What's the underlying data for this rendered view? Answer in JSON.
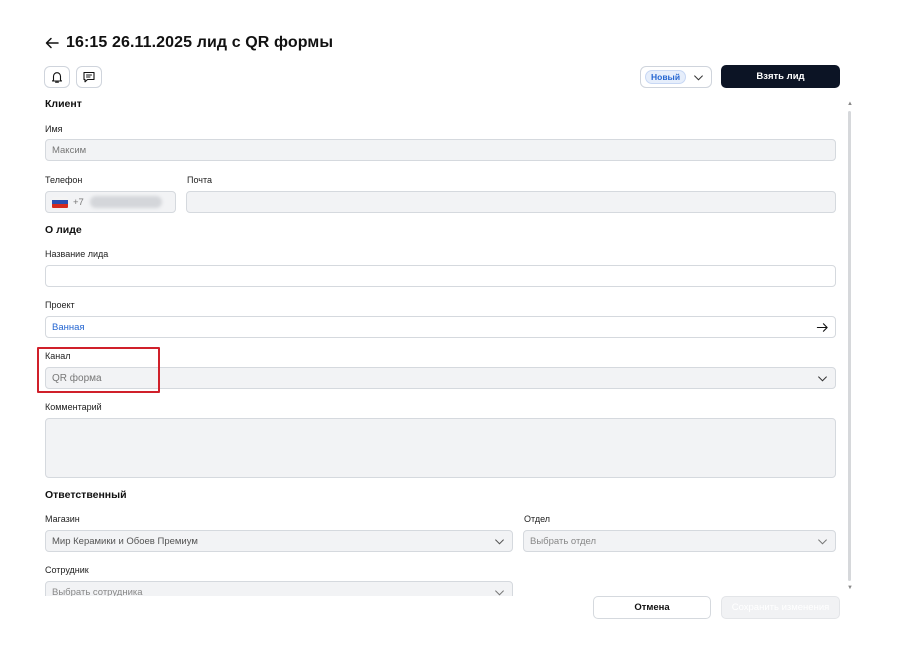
{
  "header": {
    "title": "16:15 26.11.2025 лид с QR формы",
    "status": "Новый",
    "take_lead_label": "Взять лид"
  },
  "toolbar": {
    "icons": [
      "bell-icon",
      "comment-icon"
    ]
  },
  "client": {
    "section_title": "Клиент",
    "name_label": "Имя",
    "name_value": "Максим",
    "phone_label": "Телефон",
    "phone_prefix": "+7",
    "email_label": "Почта",
    "email_value": ""
  },
  "lead": {
    "section_title": "О лиде",
    "lead_name_label": "Название лида",
    "lead_name_value": "",
    "project_label": "Проект",
    "project_value": "Ванная",
    "channel_label": "Канал",
    "channel_value": "QR форма",
    "comment_label": "Комментарий",
    "comment_value": ""
  },
  "responsible": {
    "section_title": "Ответственный",
    "store_label": "Магазин",
    "store_value": "Мир Керамики и Обоев Премиум",
    "department_label": "Отдел",
    "department_placeholder": "Выбрать отдел",
    "employee_label": "Сотрудник",
    "employee_placeholder": "Выбрать сотрудника"
  },
  "footer": {
    "cancel_label": "Отмена",
    "save_label": "Сохранить изменения"
  },
  "colors": {
    "primary": "#0c1425",
    "status_badge": "#2566d1",
    "project_link": "#2566d1",
    "highlight": "#d0202a"
  }
}
